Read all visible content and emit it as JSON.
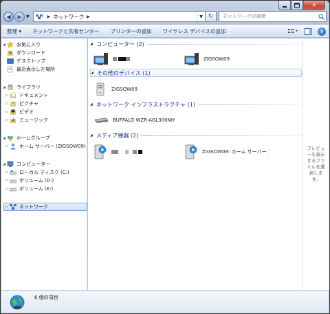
{
  "title_bar": {
    "controls": [
      "minimize",
      "maximize",
      "close"
    ],
    "close_glyph": "✕"
  },
  "address": {
    "back_icon": "back-arrow-icon",
    "forward_icon": "forward-arrow-icon",
    "path": "ネットワーク",
    "search_placeholder": "ネットワークの検索"
  },
  "toolbar": {
    "organize": "整理 ▾",
    "network_sharing_center": "ネットワークと共有センター",
    "add_printer": "プリンターの追加",
    "add_wireless_device": "ワイヤレス デバイスの追加",
    "view_icon": "view-options-icon",
    "help_glyph": "?"
  },
  "nav": {
    "favorites": "お気に入り",
    "downloads": "ダウンロード",
    "desktop": "デスクトップ",
    "recent_places": "最近表示した場所",
    "libraries": "ライブラリ",
    "documents": "ドキュメント",
    "pictures": "ピクチャ",
    "videos": "ビデオ",
    "music": "ミュージック",
    "homegroup": "ホームグループ",
    "home_server": "ホーム サーバー (ZIGSOW09)",
    "computer": "コンピューター",
    "local_disk_c": "ローカル ディスク (C:)",
    "volume_d": "ボリューム (D:)",
    "volume_e": "ボリューム (E:)",
    "network": "ネットワーク"
  },
  "groups": {
    "computers": "コンピューター (2)",
    "other_devices": "その他のデバイス (1)",
    "infrastructure": "ネットワーク インフラストラクチャ (1)",
    "media_devices": "メディア機器 (2)"
  },
  "items": {
    "computer_2": "ZIGSOW09",
    "other_device_1": "ZIGSOW09",
    "router": "BUFFALO WZR-AGL300NH",
    "media_2": "ZIGSOW09: ホーム サーバー:"
  },
  "preview": {
    "text": "プレビューを表示するファイルを選択します。"
  },
  "details": {
    "count": "6 個の項目"
  },
  "colors": {
    "group_header": "#1e3287",
    "selection_border": "#7da2ce",
    "close_button": "#c8473a"
  }
}
